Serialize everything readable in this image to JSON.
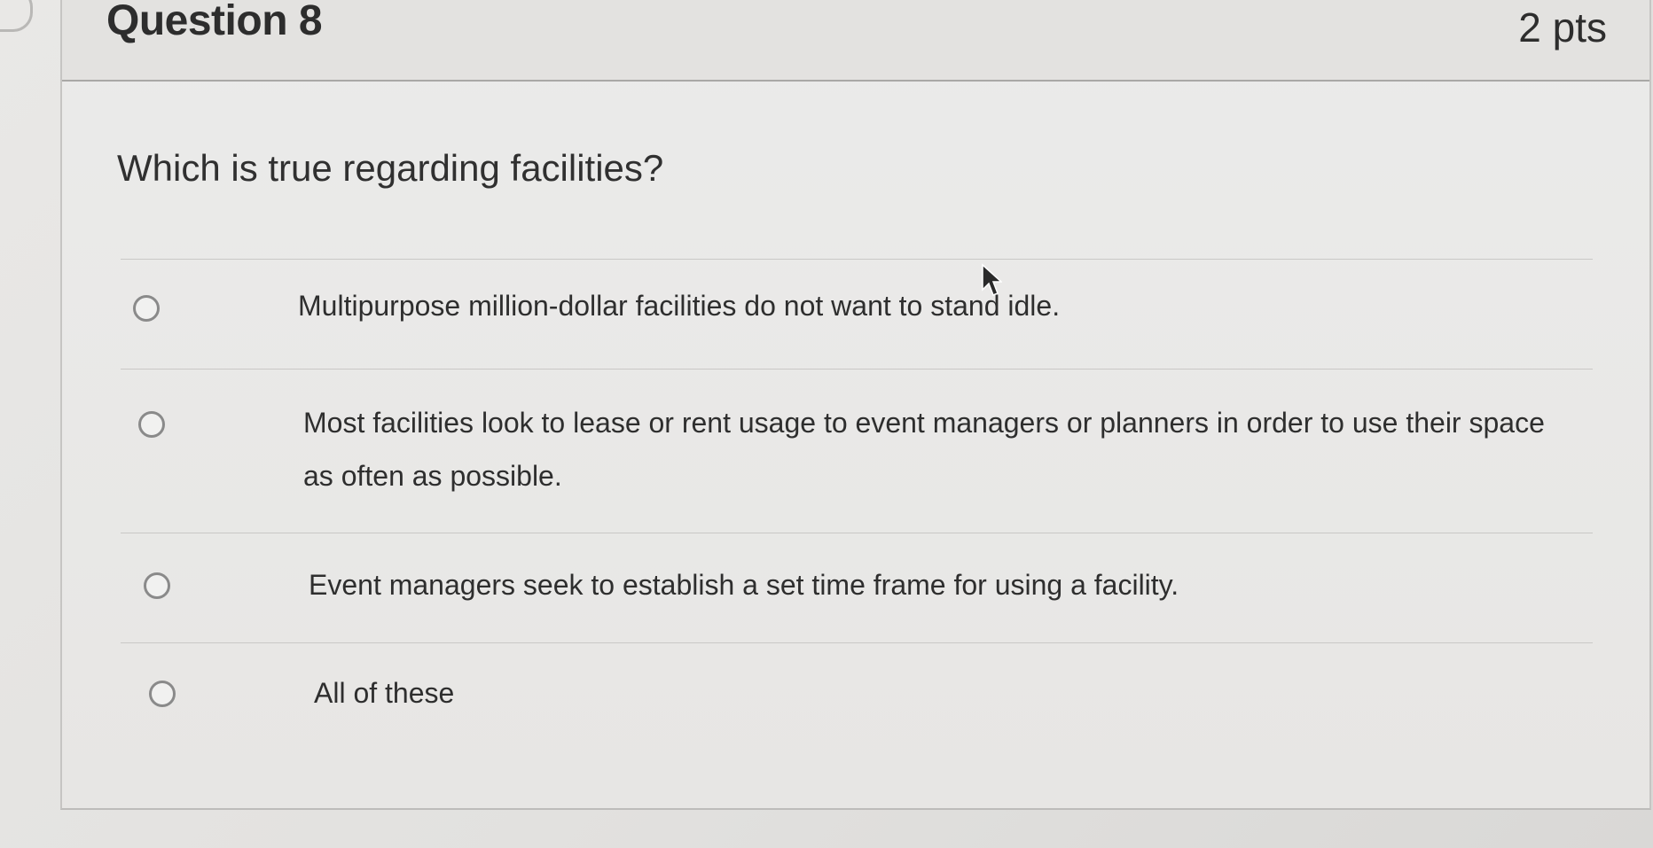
{
  "question": {
    "title": "Question 8",
    "points": "2 pts",
    "text": "Which is true regarding facilities?"
  },
  "answers": [
    {
      "label": "Multipurpose million-dollar facilities do not want to stand idle.",
      "selected": false
    },
    {
      "label": "Most facilities look to lease or rent usage to event managers or planners in order to use their space as often as possible.",
      "selected": false
    },
    {
      "label": "Event managers seek to establish a set time frame for using a facility.",
      "selected": false
    },
    {
      "label": "All of these",
      "selected": false
    }
  ],
  "icons": {
    "side_toggle": "chevron-right-icon",
    "cursor": "mouse-pointer-icon",
    "radio": "radio-unchecked-icon"
  },
  "colors": {
    "background": "#e4e3e1",
    "text": "#2d2d2d",
    "radio_border": "#8a8a8a",
    "divider": "#c9c8c6"
  }
}
